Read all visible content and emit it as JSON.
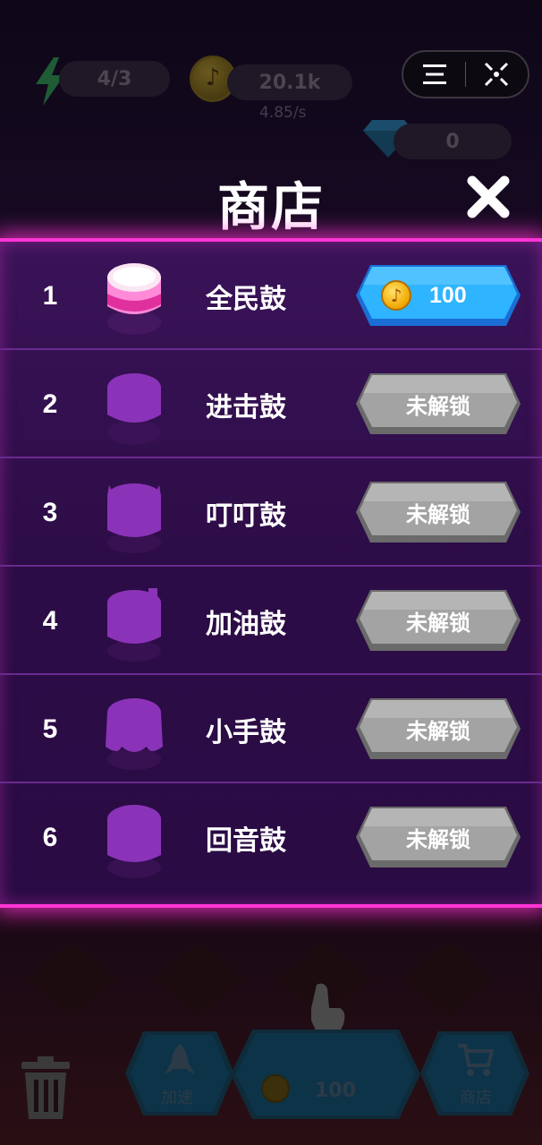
{
  "hud": {
    "energy_value": "4/3",
    "coins_value": "20.1k",
    "coins_rate": "4.85/s",
    "gems_value": "0"
  },
  "shop": {
    "title": "商店",
    "items": [
      {
        "rank": "1",
        "name": "全民鼓",
        "action": "100",
        "unlocked": true
      },
      {
        "rank": "2",
        "name": "进击鼓",
        "action": "未解锁",
        "unlocked": false
      },
      {
        "rank": "3",
        "name": "叮叮鼓",
        "action": "未解锁",
        "unlocked": false
      },
      {
        "rank": "4",
        "name": "加油鼓",
        "action": "未解锁",
        "unlocked": false
      },
      {
        "rank": "5",
        "name": "小手鼓",
        "action": "未解锁",
        "unlocked": false
      },
      {
        "rank": "6",
        "name": "回音鼓",
        "action": "未解锁",
        "unlocked": false
      }
    ]
  },
  "bottom_bar": {
    "speed_label": "加速",
    "buy_price": "100",
    "shop_label": "商店"
  },
  "colors": {
    "panel_glow": "#ff34d6",
    "buy_button": "#2fb4ff",
    "locked_button": "#a3a3a3",
    "locked_drum": "#8a33b8"
  }
}
